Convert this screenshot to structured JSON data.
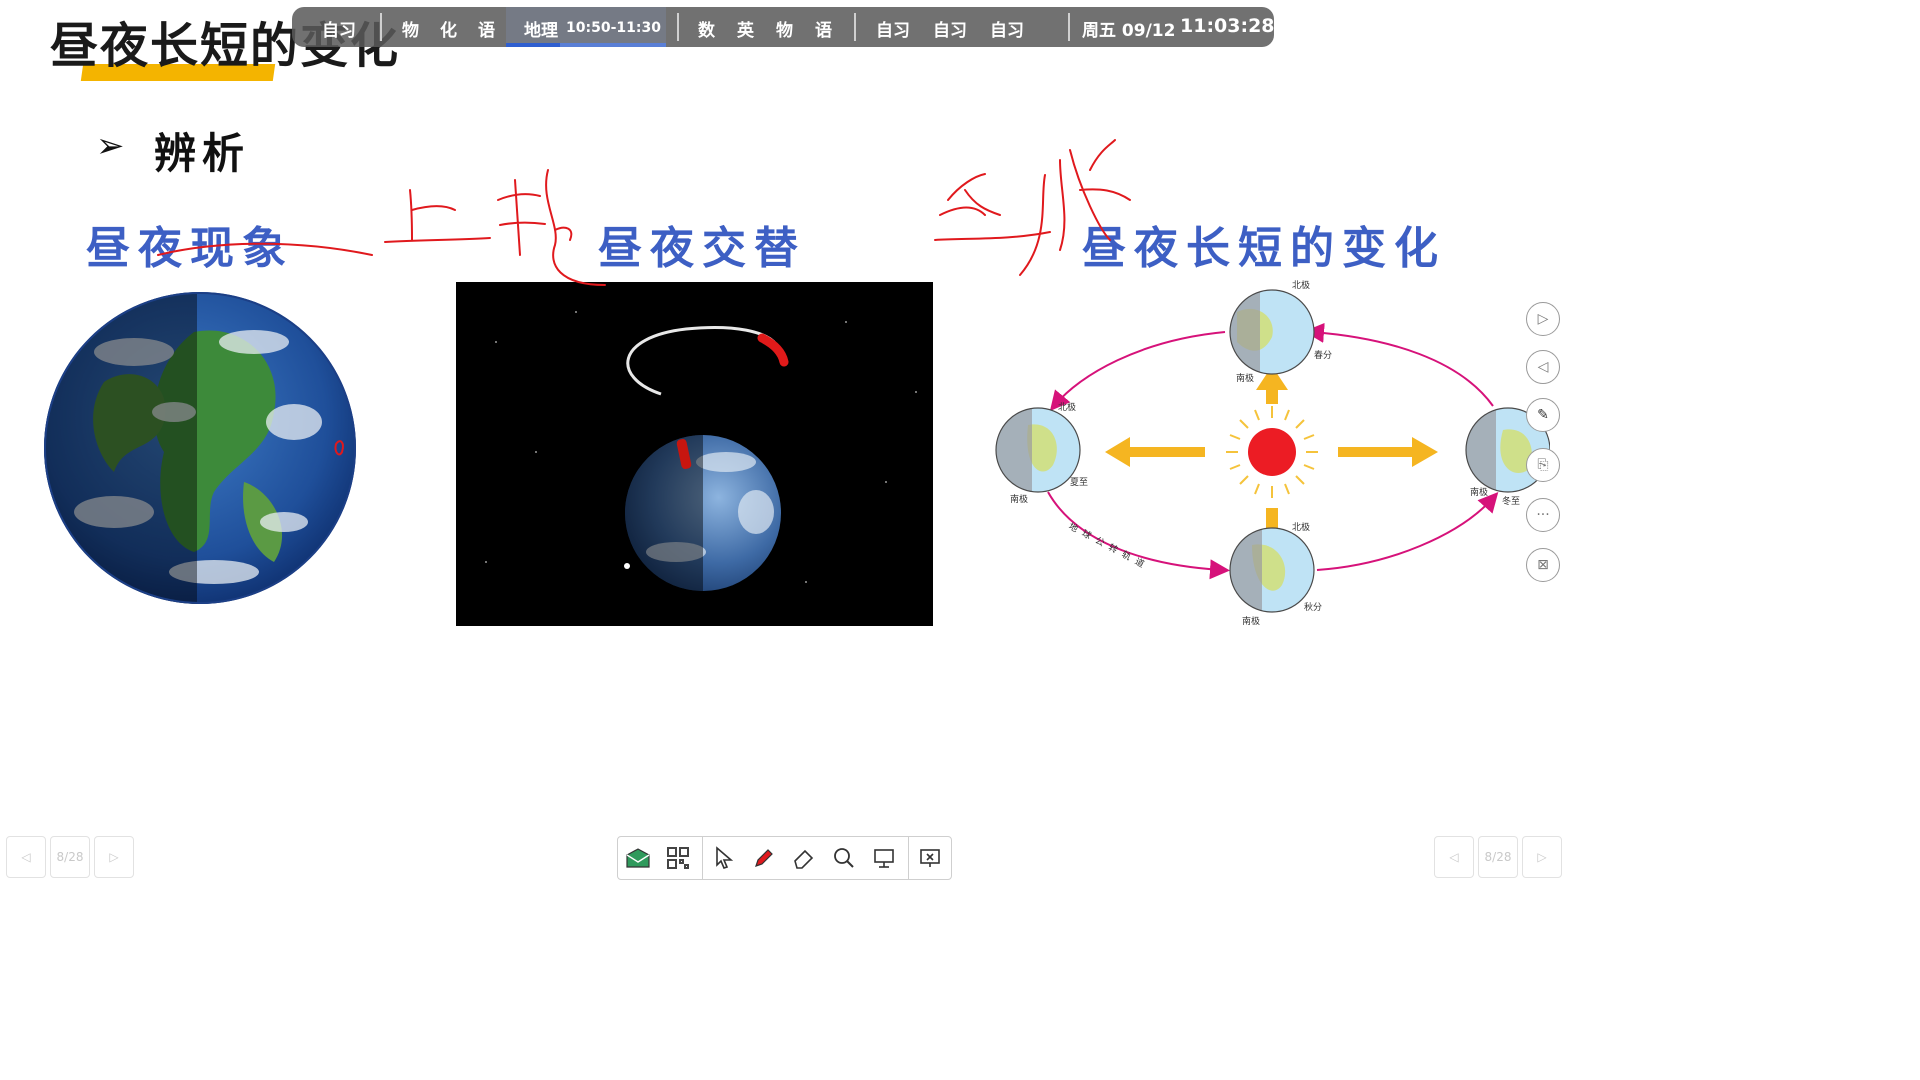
{
  "slide": {
    "title": "昼夜长短的变化",
    "bullet": "辨析",
    "concepts": [
      "昼夜现象",
      "昼夜交替",
      "昼夜长短的变化"
    ]
  },
  "schedule": {
    "items": [
      {
        "label": "自习"
      },
      {
        "label": "物"
      },
      {
        "label": "化"
      },
      {
        "label": "语"
      },
      {
        "label": "地理",
        "time": "10:50-11:30",
        "current": true
      },
      {
        "label": "数"
      },
      {
        "label": "英"
      },
      {
        "label": "物"
      },
      {
        "label": "语"
      },
      {
        "label": "自习"
      },
      {
        "label": "自习"
      },
      {
        "label": "自习"
      }
    ],
    "date": "周五 09/12",
    "clock": "11:03:28"
  },
  "orbit_diagram": {
    "labels": {
      "north_pole": "北极",
      "south_pole": "南极",
      "spring": "春分",
      "summer": "夏至",
      "autumn": "秋分",
      "winter": "冬至",
      "orbit": "地球公转轨道"
    }
  },
  "pager": {
    "left": "8/28",
    "right": "8/28"
  },
  "colors": {
    "concept_blue": "#3d5fc4",
    "title_underline": "#f4b400",
    "ink_red": "#e0191d",
    "orbit_magenta": "#d6127a",
    "arrow_orange": "#f5b521",
    "sun_red": "#ec1c24"
  },
  "icons": {
    "right_tools": [
      "play-next-icon",
      "play-prev-icon",
      "pen-settings-icon",
      "export-icon",
      "more-icon",
      "close-screen-icon"
    ],
    "bottom_toolbar": [
      "mail-icon",
      "qr-icon",
      "pointer-icon",
      "pen-icon",
      "eraser-icon",
      "zoom-icon",
      "screen-icon",
      "exit-slideshow-icon"
    ]
  }
}
